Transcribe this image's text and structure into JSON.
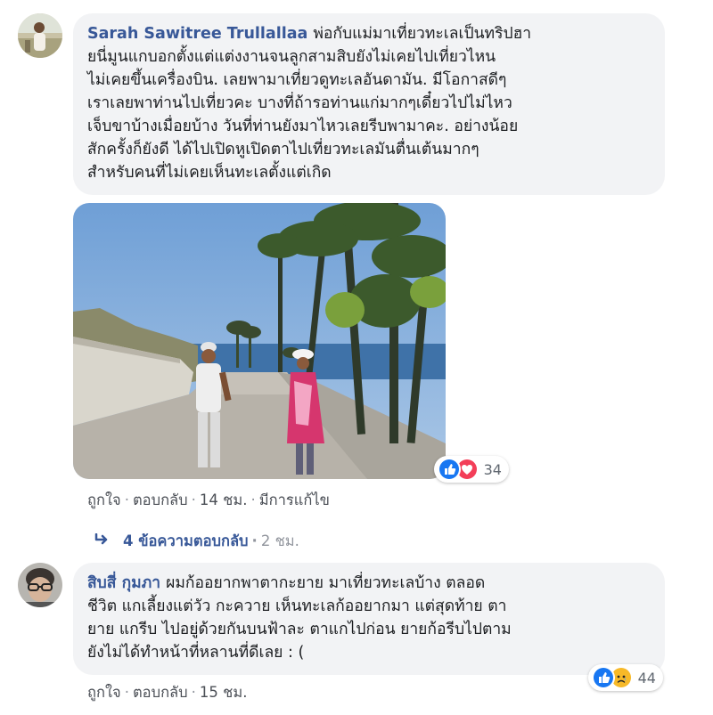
{
  "comments": [
    {
      "author": "Sarah Sawitree Trullallaa",
      "lines": [
        "พ่อกับแม่มาเที่ยวทะเลเป็นทริปฮา",
        "ยนี่มูนแกบอกตั้งแต่แต่งงานจนลูกสามสิบยังไม่เคยไปเที่ยวไหน",
        "ไม่เคยขึ้นเครื่องบิน. เลยพามาเที่ยวดูทะเลอันดามัน. มีโอกาสดีๆ",
        "เราเลยพาท่านไปเที่ยวคะ บางที่ถ้ารอท่านแก่มากๆเดี๋ยวไปไม่ไหว",
        "เจ็บขาบ้างเมื่อยบ้าง วันที่ท่านยังมาไหวเลยรีบพามาคะ. อย่างน้อย",
        "สักครั้งก็ยังดี ได้ไปเปิดหูเปิดตาไปเที่ยวทะเลมันตื่นเต้นมากๆ",
        "สำหรับคนที่ไม่เคยเห็นทะเลตั้งแต่เกิด"
      ],
      "reaction_count": "34",
      "actions": {
        "like": "ถูกใจ",
        "reply": "ตอบกลับ",
        "time": "14 ชม.",
        "edited": "มีการแก้ไข"
      },
      "replies": {
        "label": "4 ข้อความตอบกลับ",
        "time": "2 ชม."
      }
    },
    {
      "author": "สิบสี่ กุมภา",
      "lines": [
        "ผมก้ออยากพาตากะยาย มาเที่ยวทะเลบ้าง ตลอด",
        "ชีวิต แกเลี้ยงแต่วัว กะควาย เห็นทะเลก้ออยากมา แต่สุดท้าย ตา",
        "ยาย แกรีบ ไปอยู่ด้วยกันบนฟ้าละ ตาแกไปก่อน ยายก้อรีบไปตาม",
        "ยังไม่ได้ทำหน้าที่หลานที่ดีเลย : ("
      ],
      "reaction_count": "44",
      "actions": {
        "like": "ถูกใจ",
        "reply": "ตอบกลับ",
        "time": "15 ชม."
      }
    }
  ],
  "colors": {
    "link": "#385898",
    "bubble": "#f2f3f5",
    "like_blue": "#1877f2",
    "love_red": "#f33e58",
    "sad_yellow": "#f7b928"
  }
}
